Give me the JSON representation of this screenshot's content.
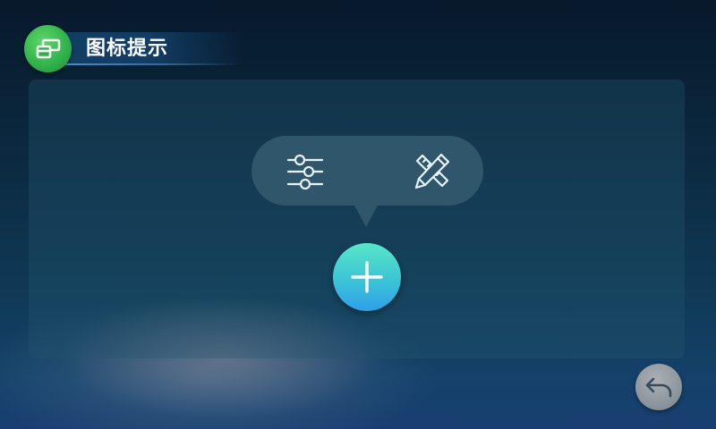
{
  "header": {
    "title": "图标提示",
    "badge_icon": "window-icon",
    "badge_color": "#2fb04a"
  },
  "tooltip": {
    "items": [
      {
        "icon": "sliders-icon"
      },
      {
        "icon": "pencil-ruler-icon"
      }
    ],
    "background": "#30566c"
  },
  "fab": {
    "icon": "plus-icon",
    "colors": [
      "#58e6c8",
      "#2f9fe8"
    ]
  },
  "back": {
    "icon": "back-arrow-icon"
  }
}
